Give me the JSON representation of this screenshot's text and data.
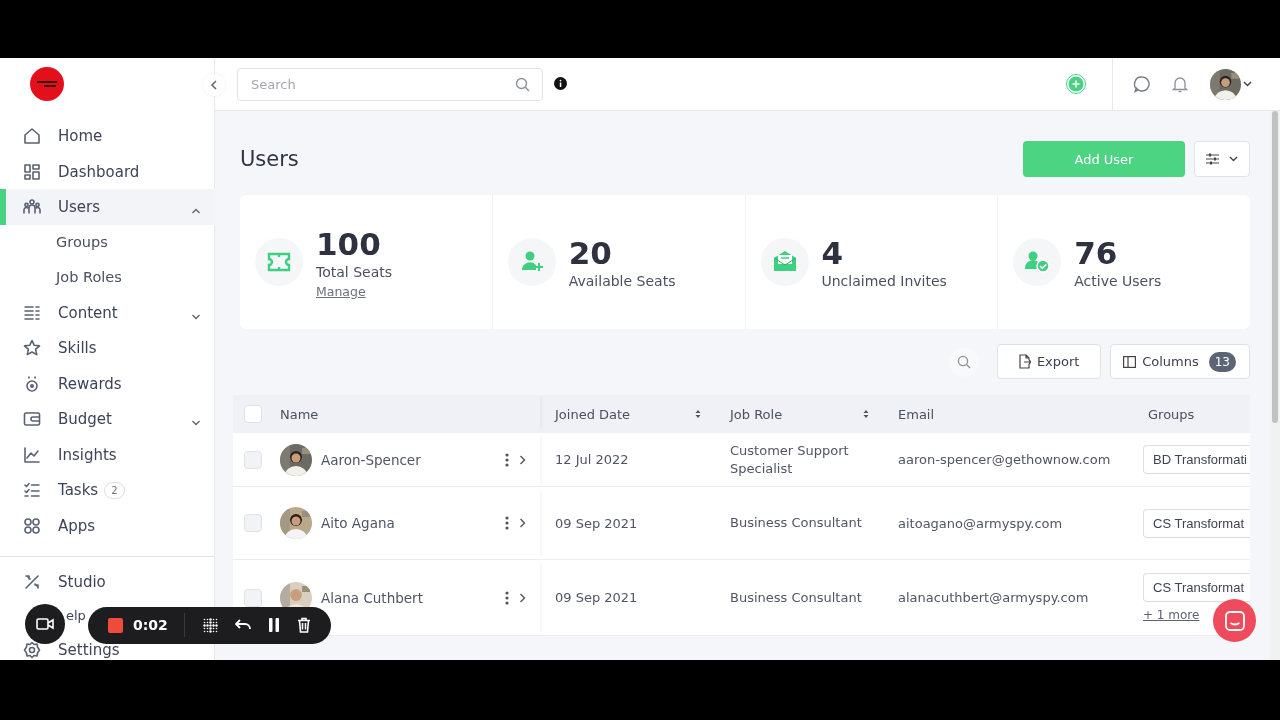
{
  "sidebar": {
    "items": [
      {
        "label": "Home",
        "selected": false
      },
      {
        "label": "Dashboard",
        "selected": false
      },
      {
        "label": "Users",
        "selected": true,
        "expanded": true,
        "children": [
          {
            "label": "Groups",
            "selected": false
          },
          {
            "label": "Job Roles",
            "selected": false
          }
        ]
      },
      {
        "label": "Content",
        "selected": false,
        "expanded": false
      },
      {
        "label": "Skills",
        "selected": false
      },
      {
        "label": "Rewards",
        "selected": false
      },
      {
        "label": "Budget",
        "selected": false,
        "expanded": false
      },
      {
        "label": "Insights",
        "selected": false
      },
      {
        "label": "Tasks",
        "selected": false,
        "badge": "2"
      },
      {
        "label": "Apps",
        "selected": false
      }
    ],
    "footer_items": [
      {
        "label": "Studio",
        "selected": false
      },
      {
        "label": "elp",
        "selected": false
      },
      {
        "label": "Settings",
        "selected": false
      }
    ]
  },
  "topbar": {
    "search": {
      "placeholder": "Search"
    }
  },
  "page": {
    "title": "Users",
    "add_button": "Add User"
  },
  "stats": [
    {
      "value": "100",
      "label": "Total Seats",
      "link": "Manage"
    },
    {
      "value": "20",
      "label": "Available Seats"
    },
    {
      "value": "4",
      "label": "Unclaimed Invites"
    },
    {
      "value": "76",
      "label": "Active Users"
    }
  ],
  "table_toolbar": {
    "export": "Export",
    "columns": "Columns",
    "column_count": "13"
  },
  "table": {
    "select_all_checked": false,
    "columns": [
      {
        "label": "Name"
      },
      {
        "label": "Joined Date",
        "sortable": true
      },
      {
        "label": "Job Role",
        "sortable": true
      },
      {
        "label": "Email"
      },
      {
        "label": "Groups"
      }
    ],
    "rows": [
      {
        "checked": false,
        "name": "Aaron-Spencer",
        "joined": "12 Jul 2022",
        "role": "Customer Support Specialist",
        "email": "aaron-spencer@gethownow.com",
        "groups": [
          "BD Transformati"
        ]
      },
      {
        "checked": false,
        "name": "Aito Agana",
        "joined": "09 Sep 2021",
        "role": "Business Consultant",
        "email": "aitoagano@armyspy.com",
        "groups": [
          "CS Transformat"
        ]
      },
      {
        "checked": false,
        "name": "Alana Cuthbert",
        "joined": "09 Sep 2021",
        "role": "Business Consultant",
        "email": "alanacuthbert@armyspy.com",
        "groups": [
          "CS Transformat"
        ],
        "more": "+ 1 more"
      }
    ]
  },
  "recorder": {
    "time": "0:02"
  }
}
